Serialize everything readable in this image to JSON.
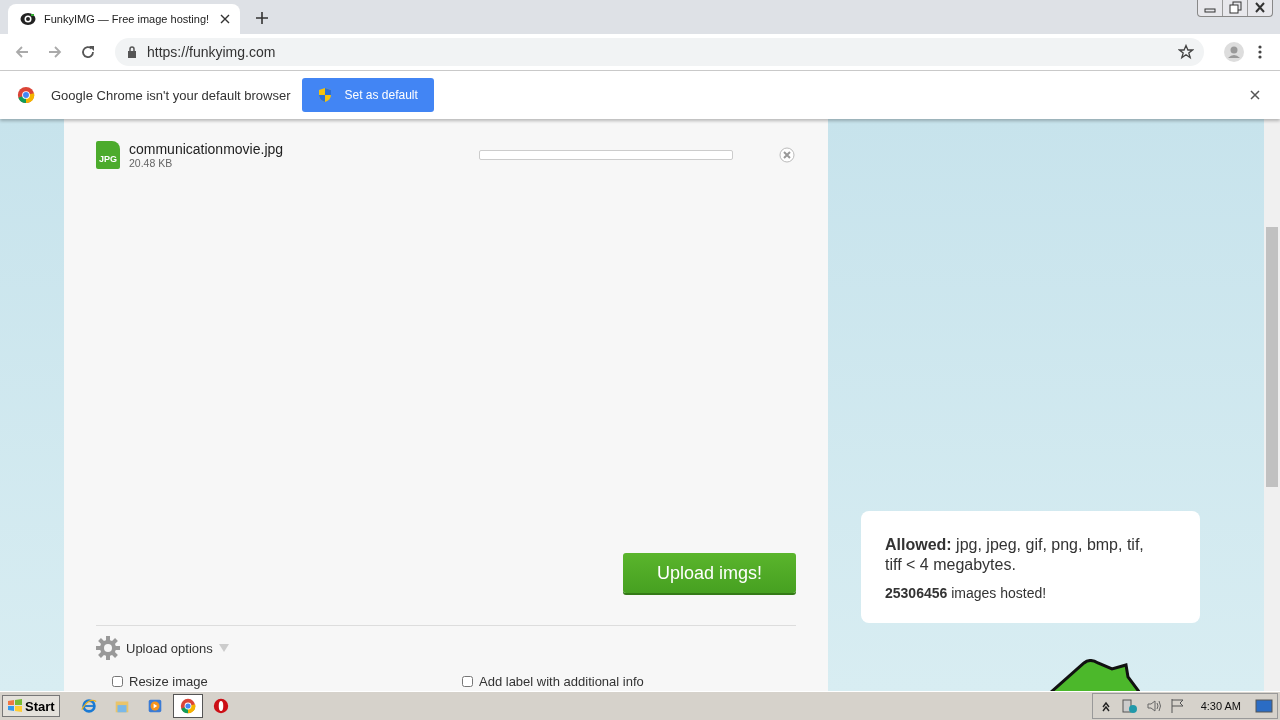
{
  "browser": {
    "tab": {
      "title": "FunkyIMG — Free image hosting!"
    },
    "address": "https://funkyimg.com"
  },
  "infobar": {
    "message": "Google Chrome isn't your default browser",
    "button": "Set as default"
  },
  "upload": {
    "files": [
      {
        "name": "communicationmovie.jpg",
        "size": "20.48 KB",
        "badge": "JPG",
        "level": 0
      }
    ],
    "button": "Upload imgs!",
    "options_label": "Upload options",
    "options": [
      {
        "label": "Resize image",
        "checked": false
      },
      {
        "label": "Add label with additional info",
        "checked": false
      }
    ]
  },
  "info": {
    "allowed": "**Allowed:** jpg, jpeg, gif, png, bmp, tif, tiff < 4 megabytes.",
    "hosted": "**25306456** images hosted!"
  },
  "taskbar": {
    "start": "Start",
    "apps": [
      {
        "kind": "ie",
        "selected": false
      },
      {
        "kind": "explorer",
        "selected": false
      },
      {
        "kind": "media",
        "selected": false
      },
      {
        "kind": "chrome",
        "selected": true
      },
      {
        "kind": "opera",
        "selected": false
      }
    ],
    "clock": "4:30 AM"
  }
}
